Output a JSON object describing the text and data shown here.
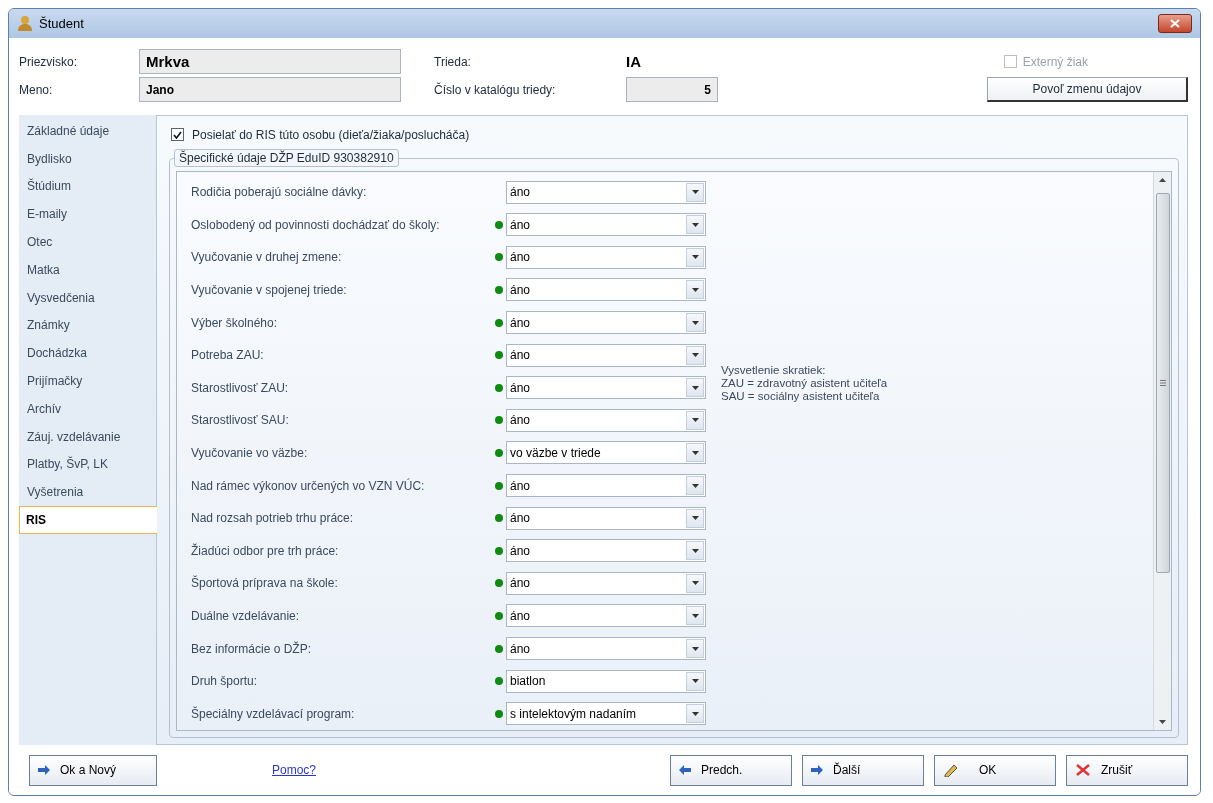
{
  "window": {
    "title": "Študent"
  },
  "header": {
    "surname_label": "Priezvisko:",
    "surname": "Mrkva",
    "name_label": "Meno:",
    "name": "Jano",
    "class_label": "Trieda:",
    "class": "IA",
    "catalog_label": "Číslo v katalógu triedy:",
    "catalog": "5",
    "external": {
      "label": "Externý žiak",
      "checked": false,
      "disabled": true
    },
    "enable_button": "Povoľ zmenu údajov"
  },
  "sidebar": {
    "items": [
      {
        "label": "Základné údaje",
        "selected": false
      },
      {
        "label": "Bydlisko",
        "selected": false
      },
      {
        "label": "Štúdium",
        "selected": false
      },
      {
        "label": "E-maily",
        "selected": false
      },
      {
        "label": "Otec",
        "selected": false
      },
      {
        "label": "Matka",
        "selected": false
      },
      {
        "label": "Vysvedčenia",
        "selected": false
      },
      {
        "label": "Známky",
        "selected": false
      },
      {
        "label": "Dochádzka",
        "selected": false
      },
      {
        "label": "Prijímačky",
        "selected": false
      },
      {
        "label": "Archív",
        "selected": false
      },
      {
        "label": "Záuj. vzdelávanie",
        "selected": false
      },
      {
        "label": "Platby, ŠvP, LK",
        "selected": false
      },
      {
        "label": "Vyšetrenia",
        "selected": false
      },
      {
        "label": "RIS",
        "selected": true
      }
    ]
  },
  "send_checkbox": {
    "label": "Posielať do RIS túto osobu (dieťa/žiaka/poslucháča)",
    "checked": true
  },
  "group": {
    "title": "Špecifické údaje DŽP EduID 930382910",
    "rows": [
      {
        "label": "Rodičia poberajú sociálne dávky:",
        "value": "áno",
        "marked": false
      },
      {
        "label": "Oslobodený od povinnosti dochádzať do školy:",
        "value": "áno",
        "marked": true
      },
      {
        "label": "Vyučovanie v druhej zmene:",
        "value": "áno",
        "marked": true
      },
      {
        "label": "Vyučovanie v spojenej triede:",
        "value": "áno",
        "marked": true
      },
      {
        "label": "Výber školného:",
        "value": "áno",
        "marked": true
      },
      {
        "label": "Potreba ZAU:",
        "value": "áno",
        "marked": true
      },
      {
        "label": "Starostlivosť ZAU:",
        "value": "áno",
        "marked": true
      },
      {
        "label": "Starostlivosť SAU:",
        "value": "áno",
        "marked": true
      },
      {
        "label": "Vyučovanie vo väzbe:",
        "value": "vo väzbe v triede",
        "marked": true
      },
      {
        "label": "Nad rámec výkonov určených vo VZN VÚC:",
        "value": "áno",
        "marked": true
      },
      {
        "label": "Nad rozsah potrieb trhu práce:",
        "value": "áno",
        "marked": true
      },
      {
        "label": "Žiadúci odbor pre trh práce:",
        "value": "áno",
        "marked": true
      },
      {
        "label": "Športová príprava na škole:",
        "value": "áno",
        "marked": true
      },
      {
        "label": "Duálne vzdelávanie:",
        "value": "áno",
        "marked": true
      },
      {
        "label": "Bez informácie o DŽP:",
        "value": "áno",
        "marked": true
      },
      {
        "label": "Druh športu:",
        "value": "biatlon",
        "marked": true
      },
      {
        "label": "Špeciálny vzdelávací program:",
        "value": "s intelektovým nadaním",
        "marked": true
      }
    ],
    "legend": [
      "Vysvetlenie skratiek:",
      "ZAU = zdravotný asistent učiteľa",
      "SAU = sociálny asistent učiteľa"
    ]
  },
  "footer": {
    "ok_new": "Ok a Nový",
    "help": "Pomoc?",
    "prev": "Predch.",
    "next": "Ďalší",
    "ok": "OK",
    "cancel": "Zrušiť"
  }
}
